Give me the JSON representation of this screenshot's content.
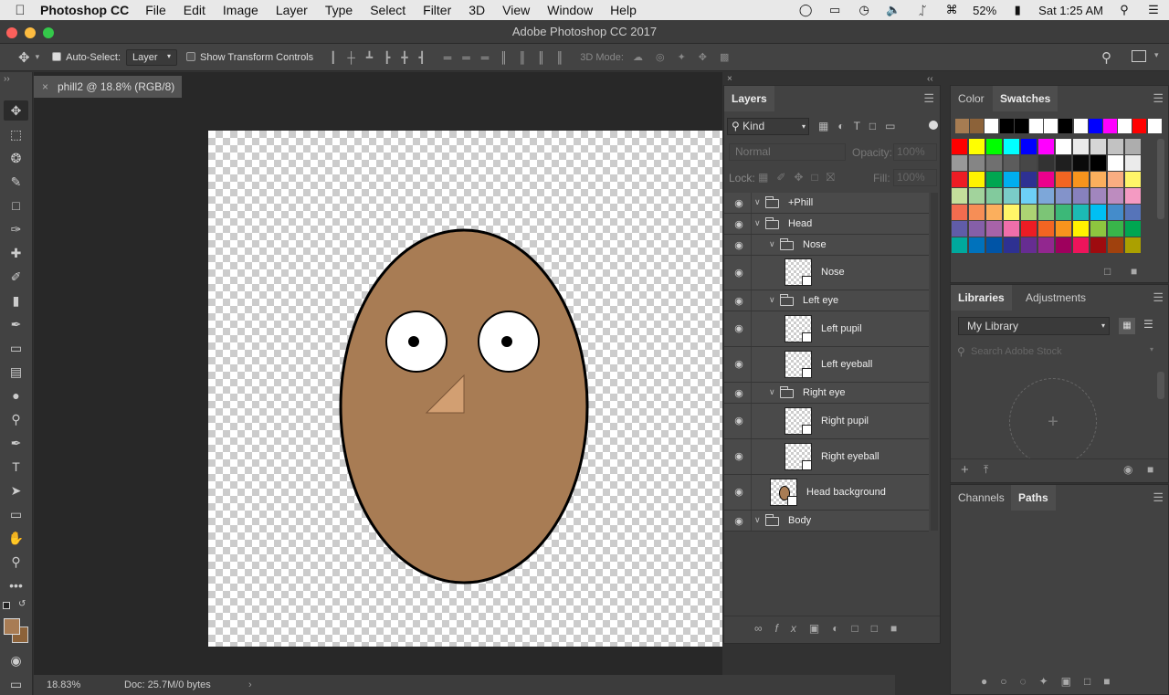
{
  "menubar": {
    "app": "Photoshop CC",
    "items": [
      "File",
      "Edit",
      "Image",
      "Layer",
      "Type",
      "Select",
      "Filter",
      "3D",
      "View",
      "Window",
      "Help"
    ],
    "battery": "52%",
    "clock": "Sat 1:25 AM"
  },
  "window": {
    "title": "Adobe Photoshop CC 2017"
  },
  "options": {
    "auto_select_label": "Auto-Select:",
    "auto_select_value": "Layer",
    "show_transform_label": "Show Transform Controls",
    "mode_3d_label": "3D Mode:"
  },
  "document": {
    "tab_title": "phill2 @ 18.8% (RGB/8)",
    "zoom": "18.83%",
    "doc_info": "Doc: 25.7M/0 bytes",
    "colors": {
      "head": "#a87c54",
      "nose": "#d29f72",
      "stroke": "#000000"
    }
  },
  "layers": {
    "tab": "Layers",
    "filter": "Kind",
    "blend_mode": "Normal",
    "opacity_label": "Opacity:",
    "opacity_value": "100%",
    "lock_label": "Lock:",
    "fill_label": "Fill:",
    "fill_value": "100%",
    "items": [
      {
        "name": "+Phill"
      },
      {
        "name": "Head"
      },
      {
        "name": "Nose"
      },
      {
        "name": "Nose"
      },
      {
        "name": "Left eye"
      },
      {
        "name": "Left pupil"
      },
      {
        "name": "Left eyeball"
      },
      {
        "name": "Right eye"
      },
      {
        "name": "Right pupil"
      },
      {
        "name": "Right eyeball"
      },
      {
        "name": "Head background"
      },
      {
        "name": "Body"
      }
    ]
  },
  "color_panel": {
    "tabs": [
      "Color",
      "Swatches"
    ]
  },
  "libraries": {
    "tabs": [
      "Libraries",
      "Adjustments"
    ],
    "library": "My Library",
    "search_placeholder": "Search Adobe Stock"
  },
  "paths_panel": {
    "tabs": [
      "Channels",
      "Paths"
    ]
  },
  "swatch_colors": [
    [
      "#a67c52",
      "#8c6239",
      "#ffffff",
      "#000000",
      "#000000",
      "#ffffff",
      "#ffffff",
      "#000000",
      "#ffffff",
      "#0000ff",
      "#ff00ff",
      "#ffffff",
      "#ff0000",
      "#ffffff"
    ],
    [
      "#ff0000",
      "#ffff00",
      "#00ff00",
      "#00ffff",
      "#0000ff",
      "#ff00ff",
      "#ffffff",
      "#ebebeb",
      "#d6d6d6",
      "#c2c2c2",
      "#adadad"
    ],
    [
      "#999999",
      "#858585",
      "#707070",
      "#5c5c5c",
      "#474747",
      "#333333",
      "#1f1f1f",
      "#0a0a0a",
      "#000000",
      "#ffffff",
      "#ebebeb"
    ],
    [
      "#ed1c24",
      "#fff200",
      "#00a651",
      "#00aeef",
      "#2e3192",
      "#ec008c",
      "#f26522",
      "#f7941d",
      "#fbaf5d",
      "#f9ad81",
      "#fff568"
    ],
    [
      "#c4df9b",
      "#a2d39c",
      "#82ca9d",
      "#7accc8",
      "#6dcff6",
      "#7da7d9",
      "#8393ca",
      "#8781bd",
      "#a186be",
      "#bd8cbf",
      "#f49ac2"
    ],
    [
      "#f26c4f",
      "#f68e56",
      "#fbaf5d",
      "#fff568",
      "#acd373",
      "#7cc576",
      "#3cb878",
      "#1cbbb4",
      "#00bff3",
      "#448ccb",
      "#5674b9"
    ],
    [
      "#605ca8",
      "#855fa8",
      "#a763a8",
      "#f06eaa",
      "#ed1c24",
      "#f26522",
      "#f7941d",
      "#fff200",
      "#8dc63f",
      "#39b54a",
      "#00a651"
    ],
    [
      "#00a99d",
      "#0072bc",
      "#0054a6",
      "#2e3192",
      "#662d91",
      "#92278f",
      "#9e005d",
      "#ed145b",
      "#9e0b0f",
      "#a0410d",
      "#aba000"
    ]
  ]
}
